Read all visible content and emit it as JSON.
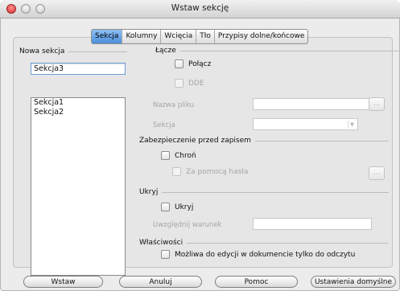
{
  "window": {
    "title": "Wstaw sekcję"
  },
  "tabs": [
    {
      "label": "Sekcja",
      "active": true
    },
    {
      "label": "Kolumny",
      "active": false
    },
    {
      "label": "Wcięcia",
      "active": false
    },
    {
      "label": "Tło",
      "active": false
    },
    {
      "label": "Przypisy dolne/końcowe",
      "active": false
    }
  ],
  "new_section": {
    "heading": "Nowa sekcja",
    "name_value": "Sekcja3",
    "existing": [
      "Sekcja1",
      "Sekcja2"
    ]
  },
  "link": {
    "heading": "Łącze",
    "link_label": "Połącz",
    "dde_label": "DDE",
    "file_name_label": "Nazwa pliku",
    "file_browse_label": "...",
    "section_label": "Sekcja",
    "section_arrow": "▼"
  },
  "write_protection": {
    "heading": "Zabezpieczenie przed zapisem",
    "protect_label": "Chroń",
    "password_label": "Za pomocą hasła",
    "password_button": "..."
  },
  "hide": {
    "heading": "Ukryj",
    "hide_label": "Ukryj",
    "condition_label": "Uwzględnij warunek"
  },
  "properties": {
    "heading": "Właściwości",
    "editable_readonly_label": "Możliwa do edycji w dokumencie tylko do odczytu"
  },
  "buttons": {
    "insert": "Wstaw",
    "cancel": "Anuluj",
    "help": "Pomoc",
    "reset": "Ustawienia domyślne"
  },
  "colors": {
    "tab_active": "#5a98de",
    "close": "#d73030"
  }
}
